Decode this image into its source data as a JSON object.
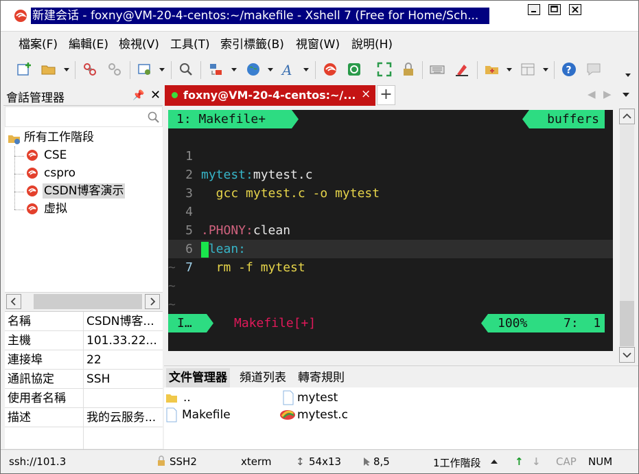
{
  "window": {
    "title": "新建会话 - foxny@VM-20-4-centos:~/makefile - Xshell 7 (Free for Home/Sch..."
  },
  "menu": [
    "檔案(F)",
    "編輯(E)",
    "檢視(V)",
    "工具(T)",
    "索引標籤(B)",
    "視窗(W)",
    "說明(H)"
  ],
  "toolbar": {
    "icons": [
      "new-session-icon",
      "open-folder-icon",
      "reconnect-icon",
      "disconnect-icon",
      "properties-icon",
      "find-icon",
      "transfer-icon",
      "globe-icon",
      "font-icon",
      "xshell-icon",
      "xftp-icon",
      "fullscreen-icon",
      "lock-icon",
      "keyboard-icon",
      "highlight-icon",
      "new-tab-group-icon",
      "layout-icon",
      "help-icon",
      "chat-icon"
    ]
  },
  "session_manager": {
    "title": "會話管理器",
    "tree": {
      "root": "所有工作階段",
      "items": [
        "CSE",
        "cspro",
        "CSDN博客演示",
        "虚拟"
      ],
      "selected_index": 2
    },
    "properties": [
      {
        "key": "名稱",
        "value": "CSDN博客..."
      },
      {
        "key": "主機",
        "value": "101.33.22..."
      },
      {
        "key": "連接埠",
        "value": "22"
      },
      {
        "key": "通訊協定",
        "value": "SSH"
      },
      {
        "key": "使用者名稱",
        "value": ""
      },
      {
        "key": "描述",
        "value": "我的云服务..."
      }
    ]
  },
  "tab": {
    "label": "foxny@VM-20-4-centos:~/...",
    "close": "×",
    "new": "+"
  },
  "terminal": {
    "tabline_left": "1: Makefile+",
    "tabline_right": "buffers",
    "lines": [
      {
        "num": "1",
        "parts": [
          {
            "text": "mytest:",
            "color": "cyan"
          },
          {
            "text": "mytest.c",
            "color": "white"
          }
        ]
      },
      {
        "num": "2",
        "parts": [
          {
            "text": "  gcc mytest.c -o mytest",
            "color": "yellow"
          }
        ]
      },
      {
        "num": "3",
        "parts": []
      },
      {
        "num": "4",
        "parts": [
          {
            "text": ".PHONY:",
            "color": "pink"
          },
          {
            "text": "clean",
            "color": "white"
          }
        ]
      },
      {
        "num": "5",
        "parts": [
          {
            "text": "clean:",
            "color": "cyan"
          }
        ]
      },
      {
        "num": "6",
        "parts": [
          {
            "text": "  rm -f mytest",
            "color": "yellow"
          }
        ]
      },
      {
        "num": "7",
        "parts": []
      }
    ],
    "tilde": "~",
    "status_mode": "I…",
    "status_file": "Makefile[+]",
    "status_percent": "100%",
    "status_pos": "7:  1",
    "colors": {
      "accent": "#2ddc82",
      "cursor": "#19e64c",
      "file": "#e0195a"
    }
  },
  "file_manager": {
    "tabs": [
      "文件管理器",
      "頻道列表",
      "轉寄規則"
    ],
    "items": [
      {
        "name": "..",
        "icon": "folder-icon"
      },
      {
        "name": "mytest",
        "icon": "file-icon"
      },
      {
        "name": "Makefile",
        "icon": "file-icon"
      },
      {
        "name": "mytest.c",
        "icon": "c-source-file-icon"
      }
    ]
  },
  "statusbar": {
    "connection": "ssh://101.3",
    "protocol": "SSH2",
    "term": "xterm",
    "size": "54x13",
    "cursor_pos": "8,5",
    "sessions": "1工作階段",
    "cap": "CAP",
    "num": "NUM"
  }
}
